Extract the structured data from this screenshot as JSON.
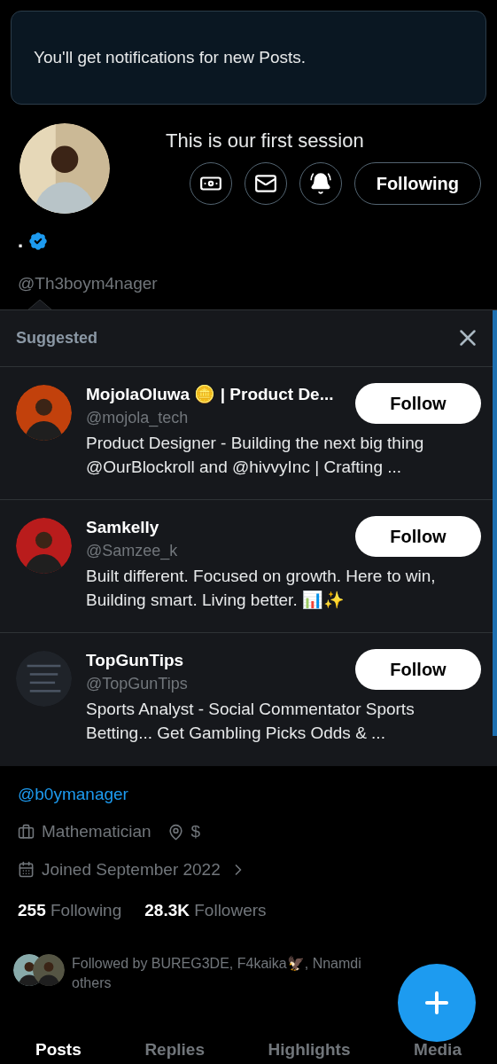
{
  "toast": {
    "message": "You'll get notifications for new Posts."
  },
  "profile": {
    "bio_lines": [
      "This is our first session"
    ],
    "actions": [
      {
        "kind": "tip"
      },
      {
        "kind": "message"
      },
      {
        "kind": "notify",
        "on": true
      }
    ],
    "follow_button": "Following",
    "name": ".",
    "verified": true,
    "handle": "@Th3boym4nager"
  },
  "suggested": {
    "title": "Suggested",
    "users": [
      {
        "name": "MojolaOluwa 🪙 | Product De...",
        "handle": "@mojola_tech",
        "bio": "Product Designer - Building the next big thing @OurBlockroll and @hivvyInc | Crafting ...",
        "button": "Follow"
      },
      {
        "name": "Samkelly",
        "handle": "@Samzee_k",
        "bio": "Built different. Focused on growth. Here to win, Building smart. Living better. 📊✨",
        "button": "Follow"
      },
      {
        "name": "TopGunTips",
        "handle": "@TopGunTips",
        "bio": "Sports Analyst - Social Commentator Sports Betting... Get Gambling Picks Odds & ...",
        "button": "Follow"
      }
    ]
  },
  "link": "@b0ymanager",
  "meta": [
    {
      "kind": "job",
      "text": "Mathematician"
    },
    {
      "kind": "location",
      "text": "$"
    }
  ],
  "joined": "Joined September 2022",
  "stats": [
    {
      "count": "255",
      "label": "Following"
    },
    {
      "count": "28.3K",
      "label": "Followers"
    }
  ],
  "followed_by": [
    "Followed by BUREG3DE, F4kaika🦅, Nnamdi",
    "others"
  ],
  "tabs": [
    {
      "label": "Posts",
      "selected": true
    },
    {
      "label": "Replies",
      "selected": false
    },
    {
      "label": "Highlights",
      "selected": false
    },
    {
      "label": "Media",
      "selected": false
    }
  ]
}
